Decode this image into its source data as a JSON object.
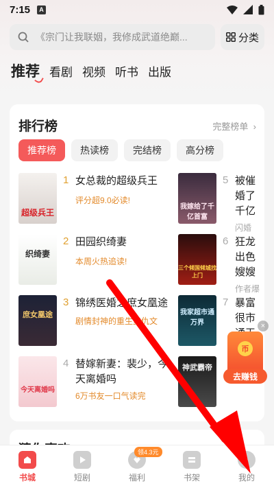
{
  "status": {
    "time": "7:15",
    "notification_letter": "A"
  },
  "search": {
    "placeholder": "《宗门让我联姻，我修成武道绝巅..."
  },
  "category_button": {
    "label": "分类"
  },
  "tabs": [
    {
      "label": "推荐",
      "active": true
    },
    {
      "label": "看剧"
    },
    {
      "label": "视频"
    },
    {
      "label": "听书"
    },
    {
      "label": "出版"
    }
  ],
  "ranking": {
    "title": "排行榜",
    "more_label": "完整榜单",
    "chips": [
      {
        "label": "推荐榜",
        "active": true
      },
      {
        "label": "热读榜"
      },
      {
        "label": "完结榜"
      },
      {
        "label": "高分榜"
      }
    ],
    "books": [
      {
        "rank": "1",
        "title": "女总裁的超级兵王",
        "tag": "评分超9.0必读!",
        "cover_text": "超级兵王"
      },
      {
        "rank": "2",
        "title": "田园织绮妻",
        "tag": "本周火热追读!",
        "cover_text": "织绮妻"
      },
      {
        "rank": "3",
        "title": "锦绣医婚之庶女凰途",
        "tag": "剧情封神的重生复仇文",
        "cover_text": "庶女凰途"
      },
      {
        "rank": "4",
        "title": "替嫁新妻：裴少，今天离婚吗",
        "tag": "6万书友一口气读完",
        "cover_text": "今天离婚吗"
      },
      {
        "rank": "5",
        "title": "被催婚了千亿",
        "tag": "闪婚",
        "cover_text": "我嫁给了千亿首富"
      },
      {
        "rank": "6",
        "title": "狂龙出色嫂嫂",
        "tag": "作者爆",
        "cover_text": "三个倾国倾城找上门"
      },
      {
        "rank": "7",
        "title": "暴富很市通天",
        "tag": "",
        "cover_text": "我家超市通万界"
      },
      {
        "rank": "8",
        "title": "",
        "tag": "",
        "cover_text": "神武霸帝"
      }
    ]
  },
  "second_section": {
    "title": "猜你喜欢"
  },
  "floating_widget": {
    "close": "×",
    "coin": "币",
    "label": "去赚钱"
  },
  "bottom_nav": [
    {
      "label": "书城",
      "active": true,
      "icon": "home-icon"
    },
    {
      "label": "短剧",
      "icon": "play-icon"
    },
    {
      "label": "福利",
      "icon": "gift-icon",
      "badge": "领4.3元"
    },
    {
      "label": "书架",
      "icon": "bookshelf-icon"
    },
    {
      "label": "我的",
      "icon": "profile-icon"
    }
  ],
  "colors": {
    "accent": "#f24b4b",
    "tag": "#e38a2b",
    "arrow": "#ff0000"
  }
}
